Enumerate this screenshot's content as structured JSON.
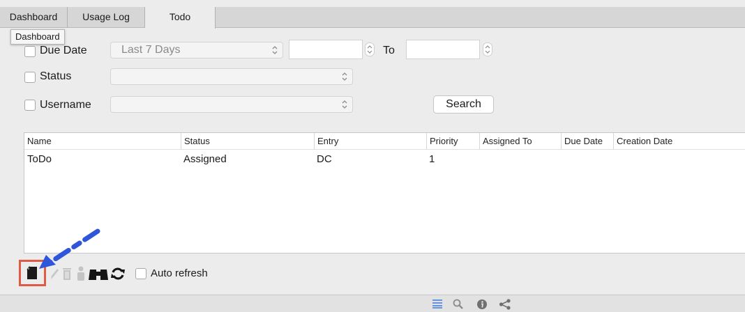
{
  "tabs": [
    {
      "label": "Dashboard"
    },
    {
      "label": "Usage Log"
    },
    {
      "label": "Todo"
    }
  ],
  "tooltip": "Dashboard",
  "filters": {
    "due_date": {
      "label": "Due Date",
      "range_value": "Last 7 Days",
      "to_label": "To"
    },
    "status": {
      "label": "Status"
    },
    "username": {
      "label": "Username"
    },
    "search_label": "Search"
  },
  "table": {
    "columns": [
      "Name",
      "Status",
      "Entry",
      "Priority",
      "Assigned To",
      "Due Date",
      "Creation Date"
    ],
    "rows": [
      {
        "name": "ToDo",
        "status": "Assigned",
        "entry": "DC",
        "priority": "1",
        "assigned_to": "",
        "due_date": "",
        "creation_date": ""
      }
    ]
  },
  "toolbar": {
    "icons": [
      "new-document-icon",
      "edit-pencil-icon",
      "trash-icon",
      "user-icon",
      "binoculars-icon",
      "refresh-icon"
    ],
    "auto_refresh_label": "Auto refresh",
    "highlight_color": "#e05a45",
    "arrow_color": "#2f56d8"
  },
  "statusbar": {
    "icons": [
      "list-icon",
      "zoom-icon",
      "info-icon",
      "share-icon"
    ],
    "accent": "#3d7bd8"
  }
}
